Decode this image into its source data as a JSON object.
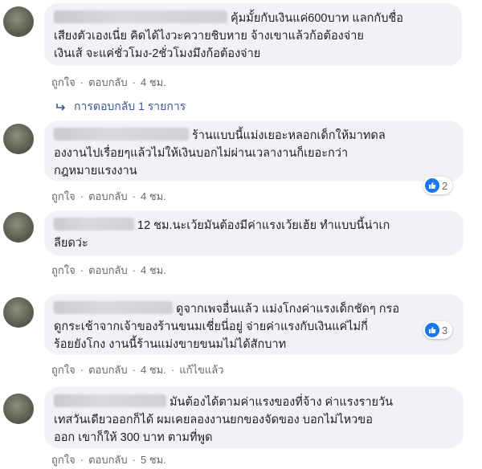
{
  "comments": [
    {
      "text_lines": [
        "คุ้มมั้ยกับเงินแค่600บาท แลกกับชื่อ",
        "เสียงตัวเองเนี่ย คิดได้ไงวะควายชิบหาย จ้างเขาแล้วก้อต้องจ่าย",
        "เงินเส้ จะแค่ชั่วโมง-2ชั่วโมงมึงก้อต้องจ่าย"
      ],
      "like": "ถูกใจ",
      "reply": "ตอบกลับ",
      "time": "4 ชม."
    },
    {
      "text_lines": [
        "ร้านแบบนี้แม่งเยอะหลอกเด็กให้มาทดล",
        "องงานไปเรื่อยๆแล้วไม่ให้เงินบอกไม่ผ่านเวลางานก็เยอะกว่า",
        "กฎหมายแรงงาน"
      ],
      "like": "ถูกใจ",
      "reply": "ตอบกลับ",
      "time": "4 ชม.",
      "reaction_count": "2"
    },
    {
      "text_lines": [
        "12 ชม.นะเว้ยมันต้องมีค่าแรงเว้ยเฮ้ย ทำแบบนี้น่าเก",
        "ลียดว่ะ"
      ],
      "like": "ถูกใจ",
      "reply": "ตอบกลับ",
      "time": "4 ชม."
    },
    {
      "text_lines": [
        "ดูจากเพจอื่นแล้ว แม่งโกงค่าแรงเด็กชัดๆ กรอ",
        "ดูกระเช้าจากเจ้าของร้านขนมเชี่ยนี่อยู่ จ่ายค่าแรงกับเงินแค่ไม่กี่",
        "ร้อยยังโกง งานนี้ร้านแม่งขายขนมไม่ได้สักบาท"
      ],
      "like": "ถูกใจ",
      "reply": "ตอบกลับ",
      "time": "4 ชม.",
      "edited": "แก้ไขแล้ว",
      "reaction_count": "3"
    },
    {
      "text_lines": [
        "มันต้องได้ตามค่าแรงของที่จ้าง ค่าแรงรายวัน",
        "เทสวันเดียวออกก็ได้ ผมเคยลองงานยกของจัดของ บอกไม่ไหวขอ",
        "ออก เขาก็ให้ 300 บาท ตามที่พูด"
      ],
      "like": "ถูกใจ",
      "reply": "ตอบกลับ",
      "time": "5 ชม."
    }
  ],
  "replies_link": "การตอบกลับ 1 รายการ",
  "icons": {
    "reply_arrow": "reply-arrow-icon",
    "like": "like-icon"
  },
  "colors": {
    "bubble": "#f0f2f5",
    "meta": "#65676b",
    "link": "#385898",
    "like_blue": "#1877f2"
  }
}
